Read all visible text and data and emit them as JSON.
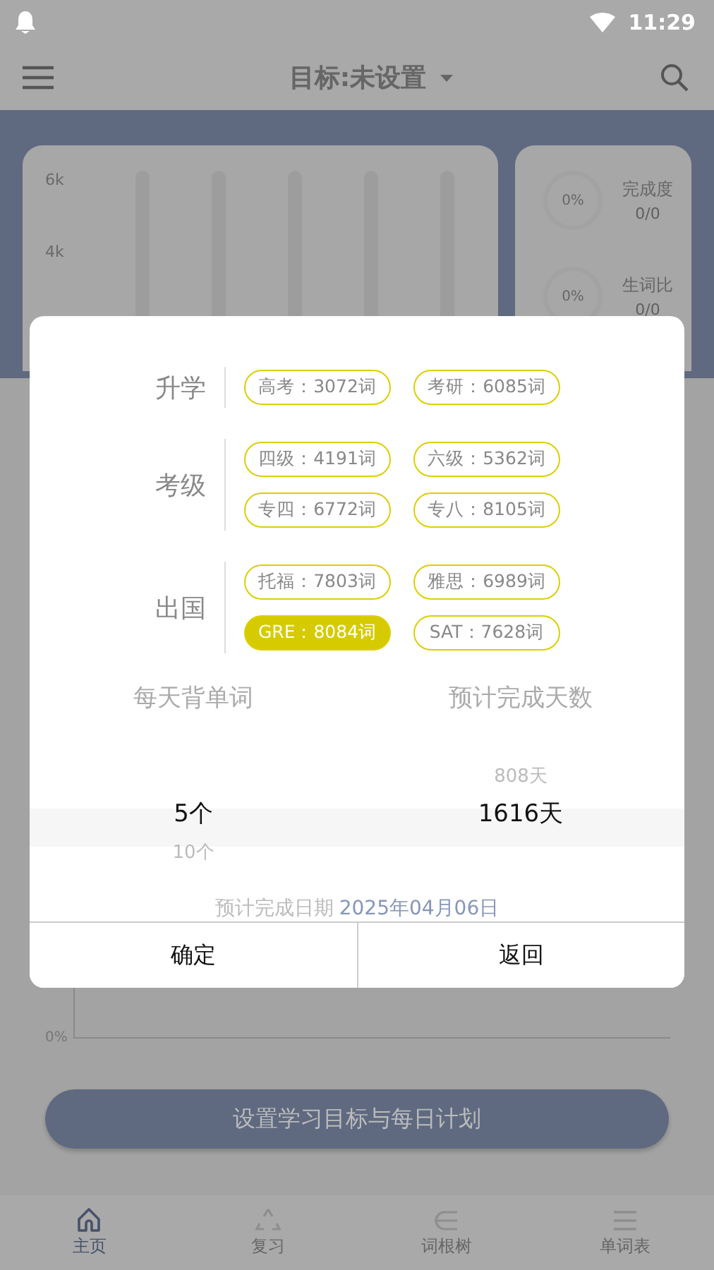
{
  "status_bar": {
    "time": "11:29"
  },
  "app_bar": {
    "title": "目标:未设置"
  },
  "background": {
    "chart_axis_labels": [
      "6k",
      "4k"
    ],
    "stats": [
      {
        "value": "0%",
        "label": "完成度",
        "count": "0/0"
      },
      {
        "value": "0%",
        "label": "生词比",
        "count": "0/0"
      }
    ],
    "lower_axis_label": "0%",
    "plan_button": "设置学习目标与每日计划"
  },
  "dialog": {
    "groups": [
      {
        "label": "升学",
        "options": [
          {
            "text": "高考：3072词",
            "selected": false
          },
          {
            "text": "考研：6085词",
            "selected": false
          }
        ]
      },
      {
        "label": "考级",
        "options": [
          {
            "text": "四级：4191词",
            "selected": false
          },
          {
            "text": "六级：5362词",
            "selected": false
          },
          {
            "text": "专四：6772词",
            "selected": false
          },
          {
            "text": "专八：8105词",
            "selected": false
          }
        ]
      },
      {
        "label": "出国",
        "options": [
          {
            "text": "托福：7803词",
            "selected": false
          },
          {
            "text": "雅思：6989词",
            "selected": false
          },
          {
            "text": "GRE：8084词",
            "selected": true
          },
          {
            "text": "SAT：7628词",
            "selected": false
          }
        ]
      }
    ],
    "pickers": [
      {
        "heading": "每天背单词",
        "items": [
          {
            "text": "5个",
            "selected": true
          },
          {
            "text": "10个",
            "selected": false
          }
        ]
      },
      {
        "heading": "预计完成天数",
        "items": [
          {
            "text": "808天",
            "selected": false
          },
          {
            "text": "1616天",
            "selected": true
          }
        ]
      }
    ],
    "finish_label": "预计完成日期",
    "finish_date": "2025年04月06日",
    "buttons": [
      "确定",
      "返回"
    ]
  },
  "bottom_nav": [
    {
      "label": "主页",
      "selected": true
    },
    {
      "label": "复习",
      "selected": false
    },
    {
      "label": "词根树",
      "selected": false
    },
    {
      "label": "单词表",
      "selected": false
    }
  ]
}
